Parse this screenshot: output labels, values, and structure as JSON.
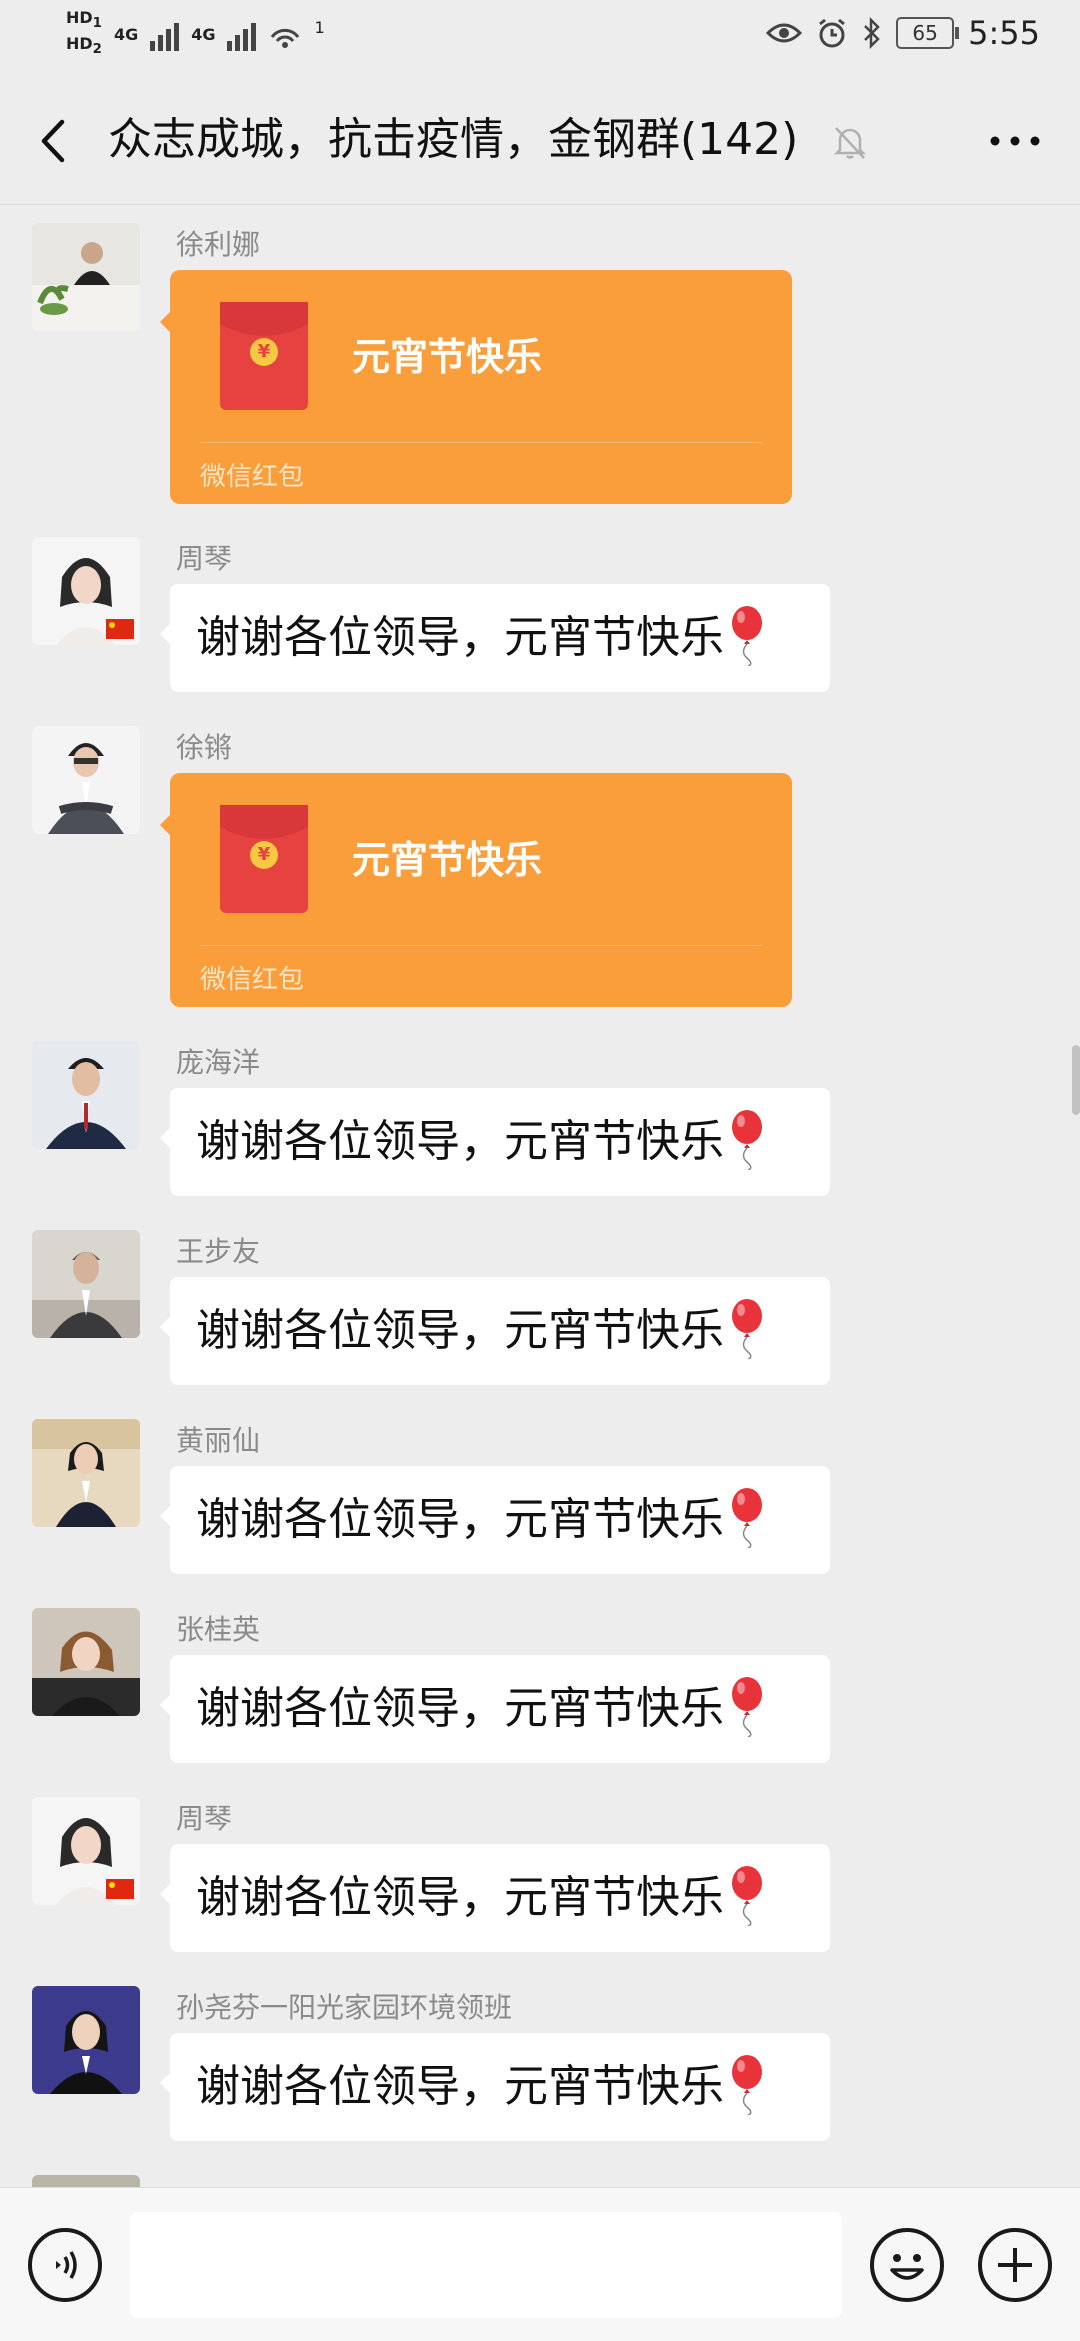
{
  "status_bar": {
    "hd1": "HD",
    "hd1_sub": "1",
    "hd2": "HD",
    "hd2_sub": "2",
    "net1": "4G",
    "net2": "4G",
    "wifi_badge": "1",
    "battery": "65",
    "time": "5:55"
  },
  "header": {
    "title": "众志成城，抗击疫情，金钢群(142)"
  },
  "messages": [
    {
      "sender": "徐利娜",
      "type": "red_packet",
      "text": "元宵节快乐",
      "label": "微信红包"
    },
    {
      "sender": "周琴",
      "type": "text",
      "text": "谢谢各位领导，元宵节快乐"
    },
    {
      "sender": "徐锵",
      "type": "red_packet",
      "text": "元宵节快乐",
      "label": "微信红包"
    },
    {
      "sender": "庞海洋",
      "type": "text",
      "text": "谢谢各位领导，元宵节快乐"
    },
    {
      "sender": "王步友",
      "type": "text",
      "text": "谢谢各位领导，元宵节快乐"
    },
    {
      "sender": "黄丽仙",
      "type": "text",
      "text": "谢谢各位领导，元宵节快乐"
    },
    {
      "sender": "张桂英",
      "type": "text",
      "text": "谢谢各位领导，元宵节快乐"
    },
    {
      "sender": "周琴",
      "type": "text",
      "text": "谢谢各位领导，元宵节快乐"
    },
    {
      "sender": "孙尧芬一阳光家园环境领班",
      "type": "text",
      "text": "谢谢各位领导，元宵节快乐"
    }
  ],
  "input_bar": {
    "text_value": ""
  },
  "colors": {
    "background": "#ededed",
    "red_packet": "#fa9d3b",
    "envelope": "#e64340",
    "bubble": "#ffffff"
  },
  "icons": [
    "back-arrow-icon",
    "mute-bell-icon",
    "more-dots-icon",
    "balloon-emoji-icon",
    "voice-icon",
    "emoji-icon",
    "plus-icon"
  ]
}
